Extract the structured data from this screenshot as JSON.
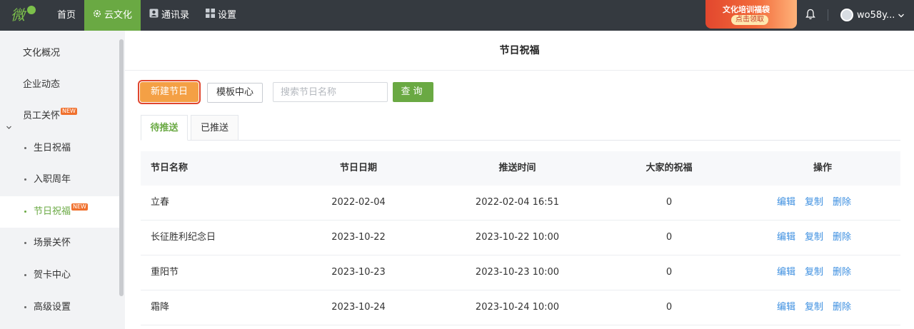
{
  "topbar": {
    "logo_text": "微",
    "nav": [
      {
        "label": "首页"
      },
      {
        "label": "云文化"
      },
      {
        "label": "通讯录"
      },
      {
        "label": "设置"
      }
    ],
    "promo": {
      "line1": "文化培训福袋",
      "line2": "点击领取"
    },
    "username": "wo58y..."
  },
  "sidebar": {
    "items": [
      {
        "label": "文化概况"
      },
      {
        "label": "企业动态"
      },
      {
        "label": "员工关怀",
        "badge": "NEW"
      },
      {
        "label": "生日祝福"
      },
      {
        "label": "入职周年"
      },
      {
        "label": "节日祝福",
        "badge": "NEW"
      },
      {
        "label": "场景关怀"
      },
      {
        "label": "贺卡中心"
      },
      {
        "label": "高级设置"
      }
    ]
  },
  "main": {
    "title": "节日祝福",
    "toolbar": {
      "new_label": "新建节日",
      "template_label": "模板中心",
      "search_placeholder": "搜索节日名称",
      "query_label": "查询"
    },
    "tabs": [
      {
        "label": "待推送"
      },
      {
        "label": "已推送"
      }
    ],
    "table": {
      "headers": [
        "节日名称",
        "节日日期",
        "推送时间",
        "大家的祝福",
        "操作"
      ],
      "rows": [
        {
          "name": "立春",
          "date": "2022-02-04",
          "time": "2022-02-04 16:51",
          "wishes": "0"
        },
        {
          "name": "长征胜利纪念日",
          "date": "2023-10-22",
          "time": "2023-10-22 10:00",
          "wishes": "0"
        },
        {
          "name": "重阳节",
          "date": "2023-10-23",
          "time": "2023-10-23 10:00",
          "wishes": "0"
        },
        {
          "name": "霜降",
          "date": "2023-10-24",
          "time": "2023-10-24 10:00",
          "wishes": "0"
        }
      ],
      "ops": {
        "edit": "编辑",
        "copy": "复制",
        "delete": "删除"
      }
    }
  },
  "colors": {
    "accent": "#6aa943",
    "primary_button": "#f4a045",
    "link": "#3d8fe0",
    "topbar": "#353a40"
  }
}
